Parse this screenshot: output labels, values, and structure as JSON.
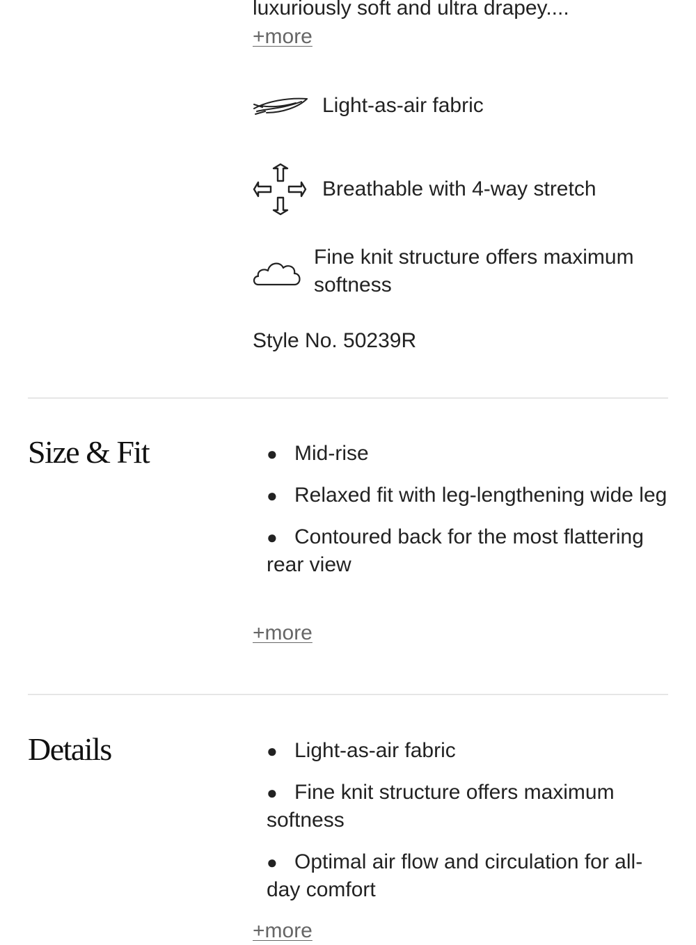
{
  "description": {
    "tail_text": "luxuriously soft and ultra drapey....",
    "more_label": "+more"
  },
  "features": [
    {
      "icon": "feather-icon",
      "label": "Light-as-air fabric"
    },
    {
      "icon": "four-way-arrows-icon",
      "label": "Breathable with 4-way stretch"
    },
    {
      "icon": "cloud-icon",
      "label_line1": "Fine knit structure offers maximum",
      "label_line2": "softness"
    }
  ],
  "style_number": "Style No. 50239R",
  "size_fit": {
    "heading": "Size & Fit",
    "items": [
      "Mid-rise",
      "Relaxed fit with leg-lengthening wide leg",
      "Contoured back for the most flattering rear view"
    ],
    "more_label": "+more"
  },
  "details": {
    "heading": "Details",
    "items": [
      "Light-as-air fabric",
      "Fine knit structure offers maximum softness",
      "Optimal air flow and circulation for all-day comfort"
    ],
    "more_label": "+more"
  },
  "colors": {
    "text": "#222222",
    "link": "#666666",
    "divider": "#e6e6e6"
  }
}
